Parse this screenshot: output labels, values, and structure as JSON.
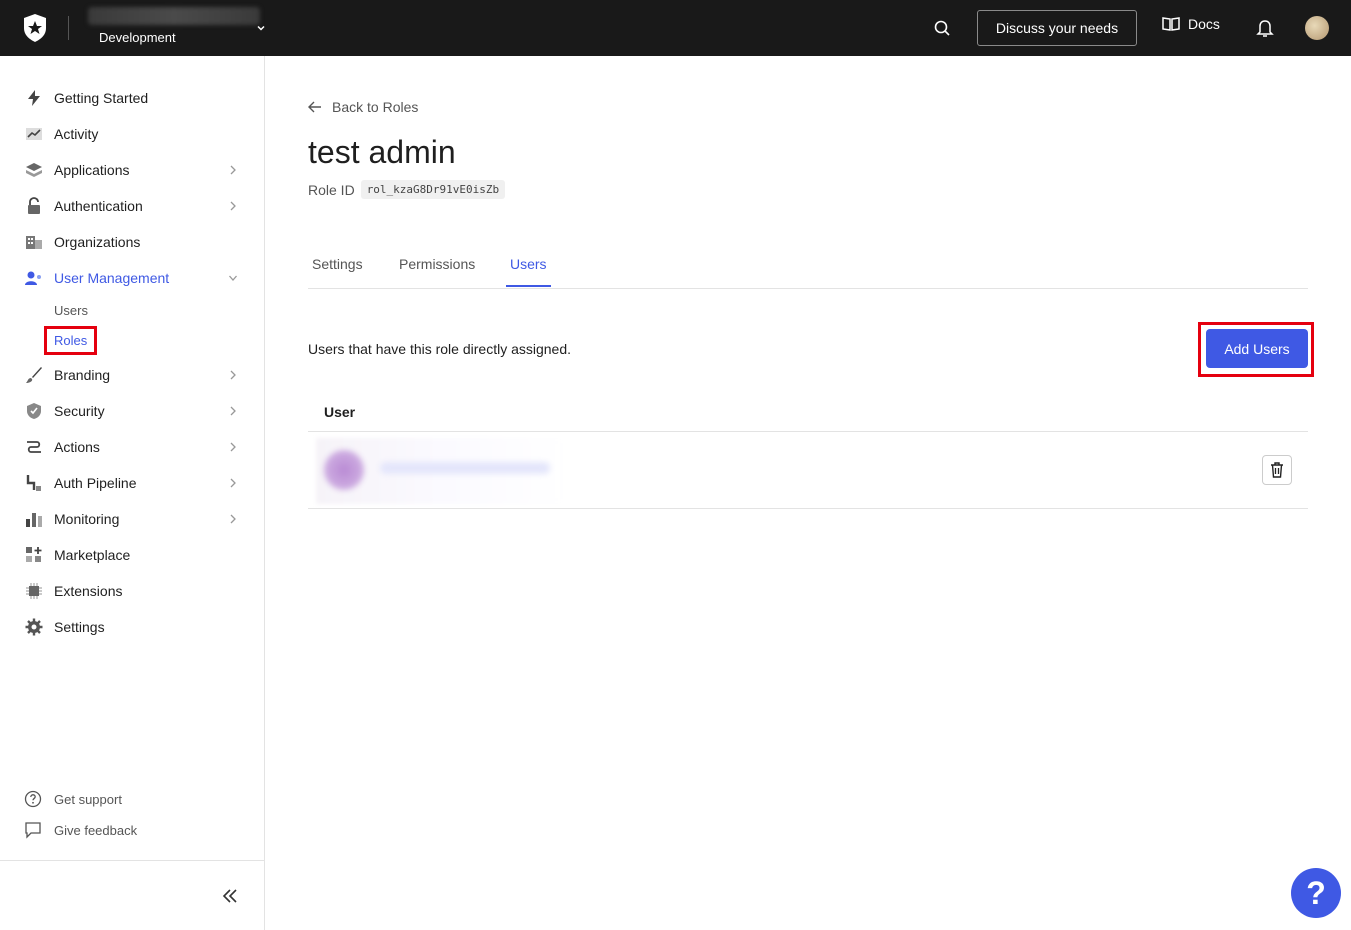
{
  "topbar": {
    "tenant_env": "Development",
    "discuss_label": "Discuss your needs",
    "docs_label": "Docs"
  },
  "sidebar": {
    "items": [
      {
        "label": "Getting Started",
        "icon": "bolt-icon"
      },
      {
        "label": "Activity",
        "icon": "activity-icon"
      },
      {
        "label": "Applications",
        "icon": "layers-icon"
      },
      {
        "label": "Authentication",
        "icon": "lock-icon"
      },
      {
        "label": "Organizations",
        "icon": "building-icon"
      },
      {
        "label": "User Management",
        "icon": "users-icon"
      },
      {
        "label": "Branding",
        "icon": "brush-icon"
      },
      {
        "label": "Security",
        "icon": "shield-icon"
      },
      {
        "label": "Actions",
        "icon": "flow-icon"
      },
      {
        "label": "Auth Pipeline",
        "icon": "pipeline-icon"
      },
      {
        "label": "Monitoring",
        "icon": "bar-chart-icon"
      },
      {
        "label": "Marketplace",
        "icon": "grid-plus-icon"
      },
      {
        "label": "Extensions",
        "icon": "chip-icon"
      },
      {
        "label": "Settings",
        "icon": "gear-icon"
      }
    ],
    "sub_items": {
      "users": "Users",
      "roles": "Roles"
    },
    "footer": {
      "support": "Get support",
      "feedback": "Give feedback"
    }
  },
  "main": {
    "back_label": "Back to Roles",
    "title": "test admin",
    "role_id_label": "Role ID",
    "role_id_value": "rol_kzaG8Dr91vE0isZb",
    "tabs": [
      {
        "label": "Settings"
      },
      {
        "label": "Permissions"
      },
      {
        "label": "Users"
      }
    ],
    "assigned_text": "Users that have this role directly assigned.",
    "add_users_label": "Add Users",
    "table": {
      "header": "User"
    }
  },
  "colors": {
    "accent": "#3f59e4",
    "topbar": "#191919",
    "highlight": "#e5000f"
  }
}
